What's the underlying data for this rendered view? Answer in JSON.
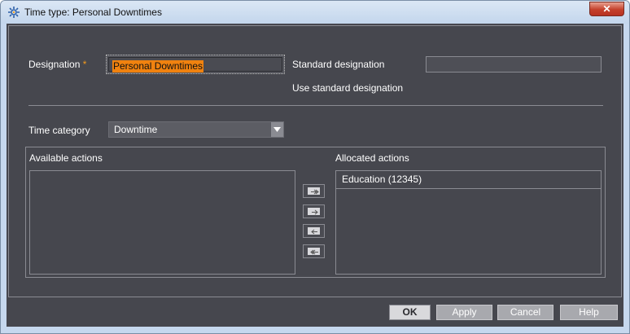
{
  "window": {
    "title": "Time type: Personal Downtimes",
    "close_glyph": "✕",
    "icon": "gear-icon"
  },
  "form": {
    "designation_label": "Designation",
    "required_marker": "*",
    "designation_value": "Personal Downtimes",
    "standard_designation_label": "Standard designation",
    "standard_designation_value": "",
    "use_standard_label": "Use standard designation",
    "time_category_label": "Time category",
    "time_category_value": "Downtime"
  },
  "actions": {
    "available_label": "Available actions",
    "available_items": [],
    "allocated_label": "Allocated actions",
    "allocated_items": [
      "Education (12345)"
    ],
    "move_buttons": [
      "move-all-right-icon",
      "move-right-icon",
      "move-left-icon",
      "move-all-left-icon"
    ]
  },
  "buttons": {
    "ok": "OK",
    "apply": "Apply",
    "cancel": "Cancel",
    "help": "Help"
  },
  "colors": {
    "background": "#46474e",
    "accent": "#f0820f",
    "titlebar": "#c6d8ee",
    "close": "#c4402b"
  }
}
